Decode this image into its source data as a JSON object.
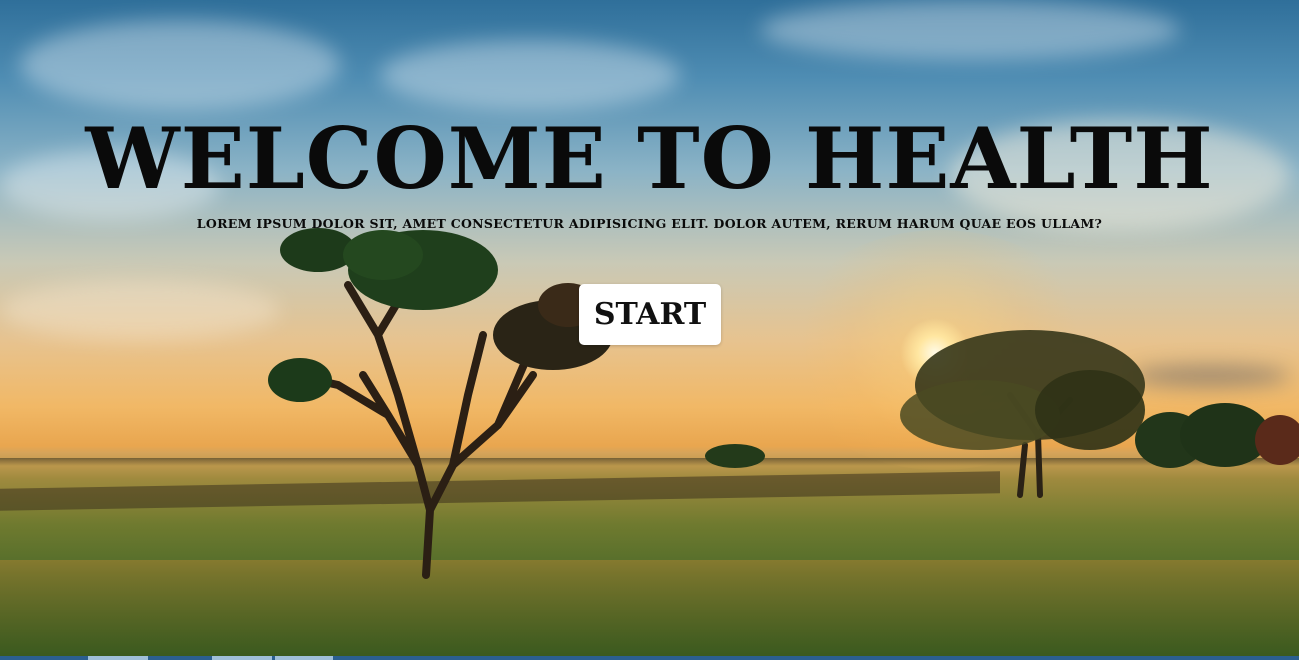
{
  "hero": {
    "title": "WELCOME TO HEALTH",
    "subtitle": "LOREM IPSUM DOLOR SIT, AMET CONSECTETUR ADIPISICING ELIT. DOLOR AUTEM, RERUM HARUM QUAE EOS ULLAM?",
    "start_label": "START"
  },
  "background": {
    "description_icon": "landscape-sunset-image"
  },
  "colors": {
    "title_text": "#0a0a0a",
    "button_bg": "#ffffff",
    "taskbar": "#2b5f8f"
  }
}
